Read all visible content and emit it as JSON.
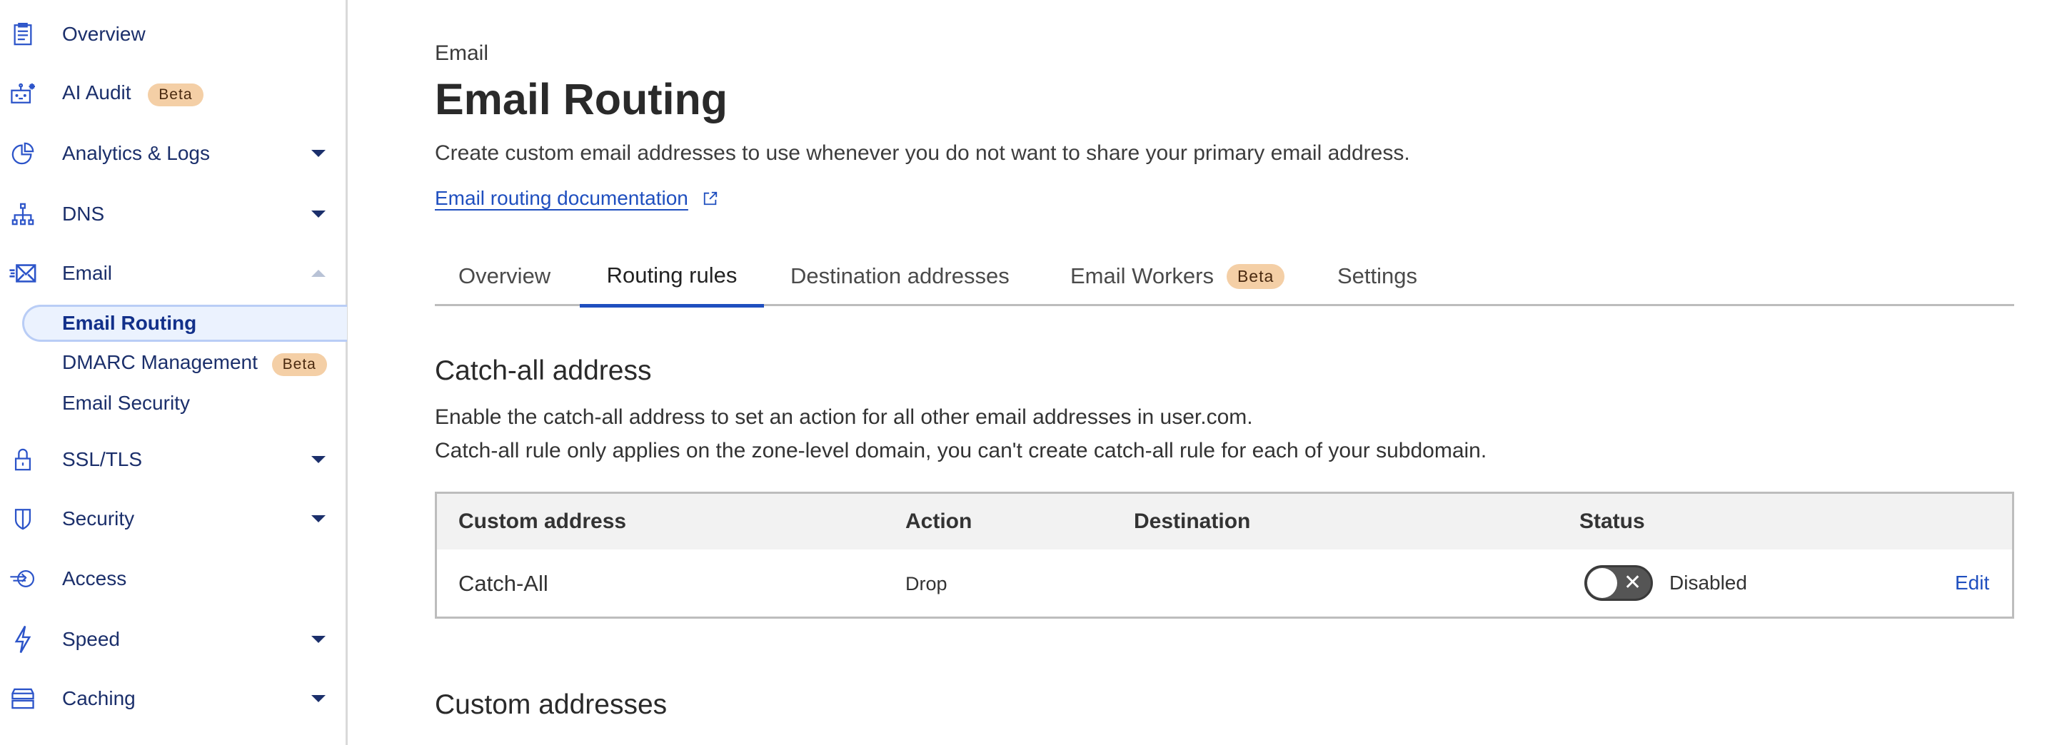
{
  "sidebar": {
    "items": [
      {
        "label": "Overview",
        "icon": "clipboard-icon"
      },
      {
        "label": "AI Audit",
        "icon": "robot-icon",
        "badge": "Beta"
      },
      {
        "label": "Analytics & Logs",
        "icon": "pie-chart-icon"
      },
      {
        "label": "DNS",
        "icon": "network-icon"
      },
      {
        "label": "Email",
        "icon": "envelope-icon"
      },
      {
        "label": "SSL/TLS",
        "icon": "lock-icon"
      },
      {
        "label": "Security",
        "icon": "shield-icon"
      },
      {
        "label": "Access",
        "icon": "access-icon"
      },
      {
        "label": "Speed",
        "icon": "lightning-icon"
      },
      {
        "label": "Caching",
        "icon": "server-icon"
      }
    ],
    "email_sub": [
      {
        "label": "Email Routing"
      },
      {
        "label": "DMARC Management",
        "badge": "Beta"
      },
      {
        "label": "Email Security"
      }
    ]
  },
  "header": {
    "section": "Email",
    "title": "Email Routing",
    "description": "Create custom email addresses to use whenever you do not want to share your primary email address.",
    "doc_link": "Email routing documentation"
  },
  "tabs": [
    {
      "label": "Overview"
    },
    {
      "label": "Routing rules"
    },
    {
      "label": "Destination addresses"
    },
    {
      "label": "Email Workers",
      "badge": "Beta"
    },
    {
      "label": "Settings"
    }
  ],
  "catch_all": {
    "heading": "Catch-all address",
    "line1": "Enable the catch-all address to set an action for all other email addresses in user.com.",
    "line2": "Catch-all rule only applies on the zone-level domain, you can't create catch-all rule for each of your subdomain.",
    "columns": [
      "Custom address",
      "Action",
      "Destination",
      "Status"
    ],
    "row": {
      "address": "Catch-All",
      "action": "Drop",
      "destination": "",
      "status": "Disabled",
      "enabled": false,
      "edit": "Edit"
    }
  },
  "custom": {
    "heading": "Custom addresses"
  },
  "colors": {
    "accent": "#1f4fbf",
    "nav_text": "#1b2f6b",
    "icon": "#2c54c9",
    "badge": "#f4cfa6"
  }
}
